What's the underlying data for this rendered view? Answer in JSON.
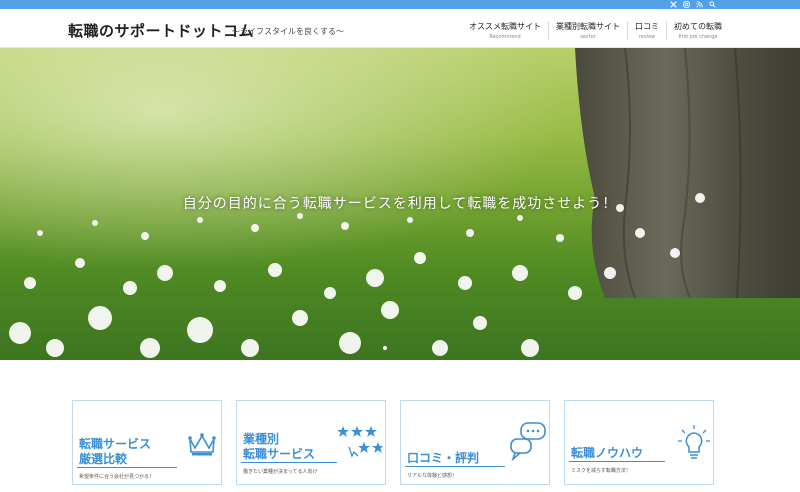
{
  "topbar": {
    "icons": [
      "x-icon",
      "instagram-icon",
      "rss-icon",
      "search-icon"
    ]
  },
  "header": {
    "logo": "転職のサポートドットコム",
    "tagline": "〜ライフスタイルを良くする〜"
  },
  "nav": [
    {
      "label": "オススメ転職サイト",
      "sub": "Recommend"
    },
    {
      "label": "業種別転職サイト",
      "sub": "sector"
    },
    {
      "label": "口コミ",
      "sub": "review"
    },
    {
      "label": "初めての転職",
      "sub": "first job change"
    }
  ],
  "hero": {
    "caption": "自分の目的に合う転職サービスを利用して転職を成功させよう！"
  },
  "cards": [
    {
      "title_line1": "転職サービス",
      "title_line2": "厳選比較",
      "desc": "希望条件に合う会社が見つかる！",
      "icon": "crown-icon"
    },
    {
      "title_line1": "業種別",
      "title_line2": "転職サービス",
      "desc": "働きたい業種が決まってる人向け",
      "icon": "stars-icon"
    },
    {
      "title_line1": "口コミ・評判",
      "title_line2": "",
      "desc": "リアルな体験と感想！",
      "icon": "chat-bubble-icon"
    },
    {
      "title_line1": "転職ノウハウ",
      "title_line2": "",
      "desc": "ミスクを減らす転職方法！",
      "icon": "lightbulb-icon"
    }
  ],
  "colors": {
    "topbar": "#52a0e6",
    "card_accent": "#3b8fd7"
  }
}
